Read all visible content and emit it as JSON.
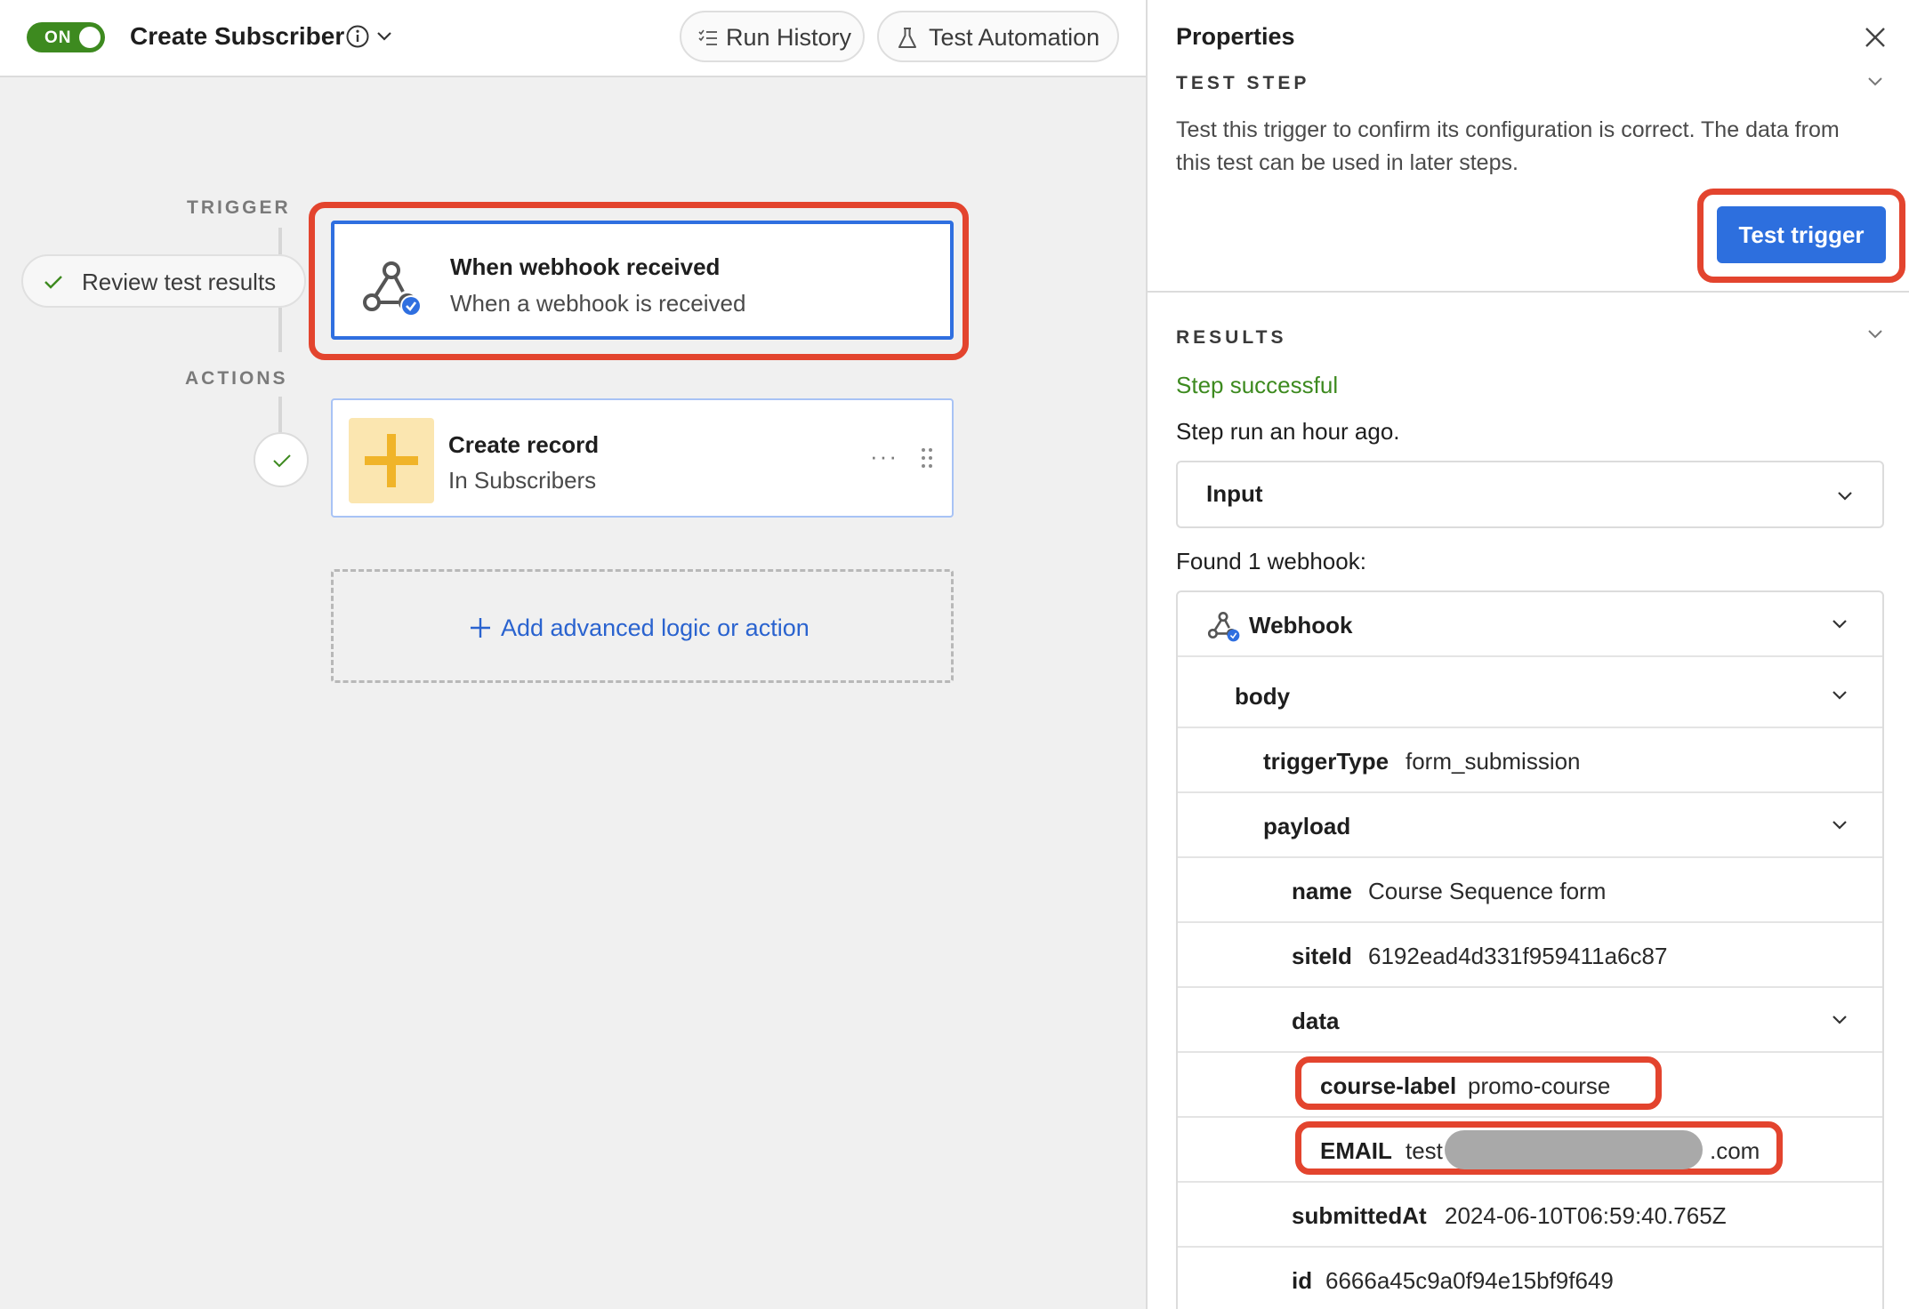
{
  "topbar": {
    "toggle_label": "ON",
    "title": "Create Subscriber",
    "run_history_label": "Run History",
    "test_automation_label": "Test Automation"
  },
  "canvas": {
    "trigger_label": "TRIGGER",
    "actions_label": "ACTIONS",
    "review_label": "Review test results",
    "trigger_card": {
      "title": "When webhook received",
      "subtitle": "When a webhook is received"
    },
    "action_card": {
      "title": "Create record",
      "subtitle": "In Subscribers",
      "more": "···"
    },
    "add_label": "Add advanced logic or action"
  },
  "panel": {
    "title": "Properties",
    "test_step": {
      "heading": "TEST STEP",
      "description": "Test this trigger to confirm its configuration is correct. The data from this test can be used in later steps.",
      "button_label": "Test trigger"
    },
    "results": {
      "heading": "RESULTS",
      "status": "Step successful",
      "ran_at": "Step run an hour ago.",
      "input_label": "Input",
      "found_text": "Found 1 webhook:",
      "tree": {
        "webhook_label": "Webhook",
        "body_label": "body",
        "trigger_type_key": "triggerType",
        "trigger_type_value": "form_submission",
        "payload_label": "payload",
        "name_key": "name",
        "name_value": "Course Sequence form",
        "site_id_key": "siteId",
        "site_id_value": "6192ead4d331f959411a6c87",
        "data_label": "data",
        "course_label_key": "course-label",
        "course_label_value": "promo-course",
        "email_key": "EMAIL",
        "email_prefix": "test",
        "email_suffix": ".com",
        "submitted_at_key": "submittedAt",
        "submitted_at_value": "2024-06-10T06:59:40.765Z",
        "id_key": "id",
        "id_value": "6666a45c9a0f94e15bf9f649"
      }
    }
  },
  "colors": {
    "accent_blue": "#2d6fde",
    "success_green": "#3d8a1f",
    "highlight_red": "#e3442e",
    "action_yellow": "#f0b429"
  }
}
